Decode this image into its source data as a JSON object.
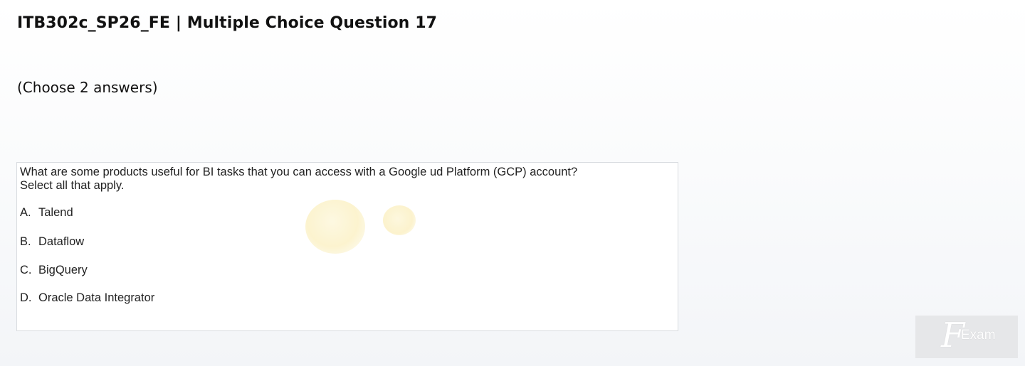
{
  "header": {
    "title": "ITB302c_SP26_FE | Multiple Choice Question 17"
  },
  "instruction": "(Choose 2 answers)",
  "question": {
    "line1": "What are some products useful for BI tasks that you can access with a Google ud Platform (GCP) account?",
    "line2": "Select all that apply.",
    "options": [
      {
        "letter": "A.",
        "text": "Talend"
      },
      {
        "letter": "B.",
        "text": "Dataflow"
      },
      {
        "letter": "C.",
        "text": "BigQuery"
      },
      {
        "letter": "D.",
        "text": "Oracle Data Integrator"
      }
    ]
  },
  "watermark": {
    "letter": "F",
    "text": "Exam"
  }
}
